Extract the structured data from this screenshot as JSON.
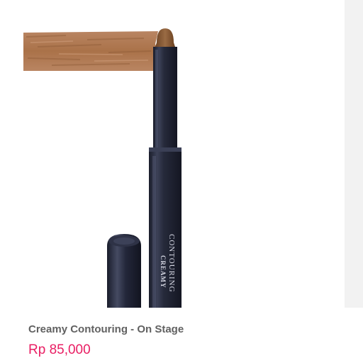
{
  "product": {
    "title": "Creamy Contouring - On Stage",
    "price": "Rp 85,000",
    "image": {
      "stick_label_line1": "CREAMY",
      "stick_label_line2": "CONTOURING"
    }
  },
  "colors": {
    "price": "#e91e63",
    "title": "#616161",
    "swatch": "#b07a52",
    "stick_body": "#262a3a",
    "stick_tip": "#8a5a33",
    "right_gutter": "#f2f2f2"
  }
}
